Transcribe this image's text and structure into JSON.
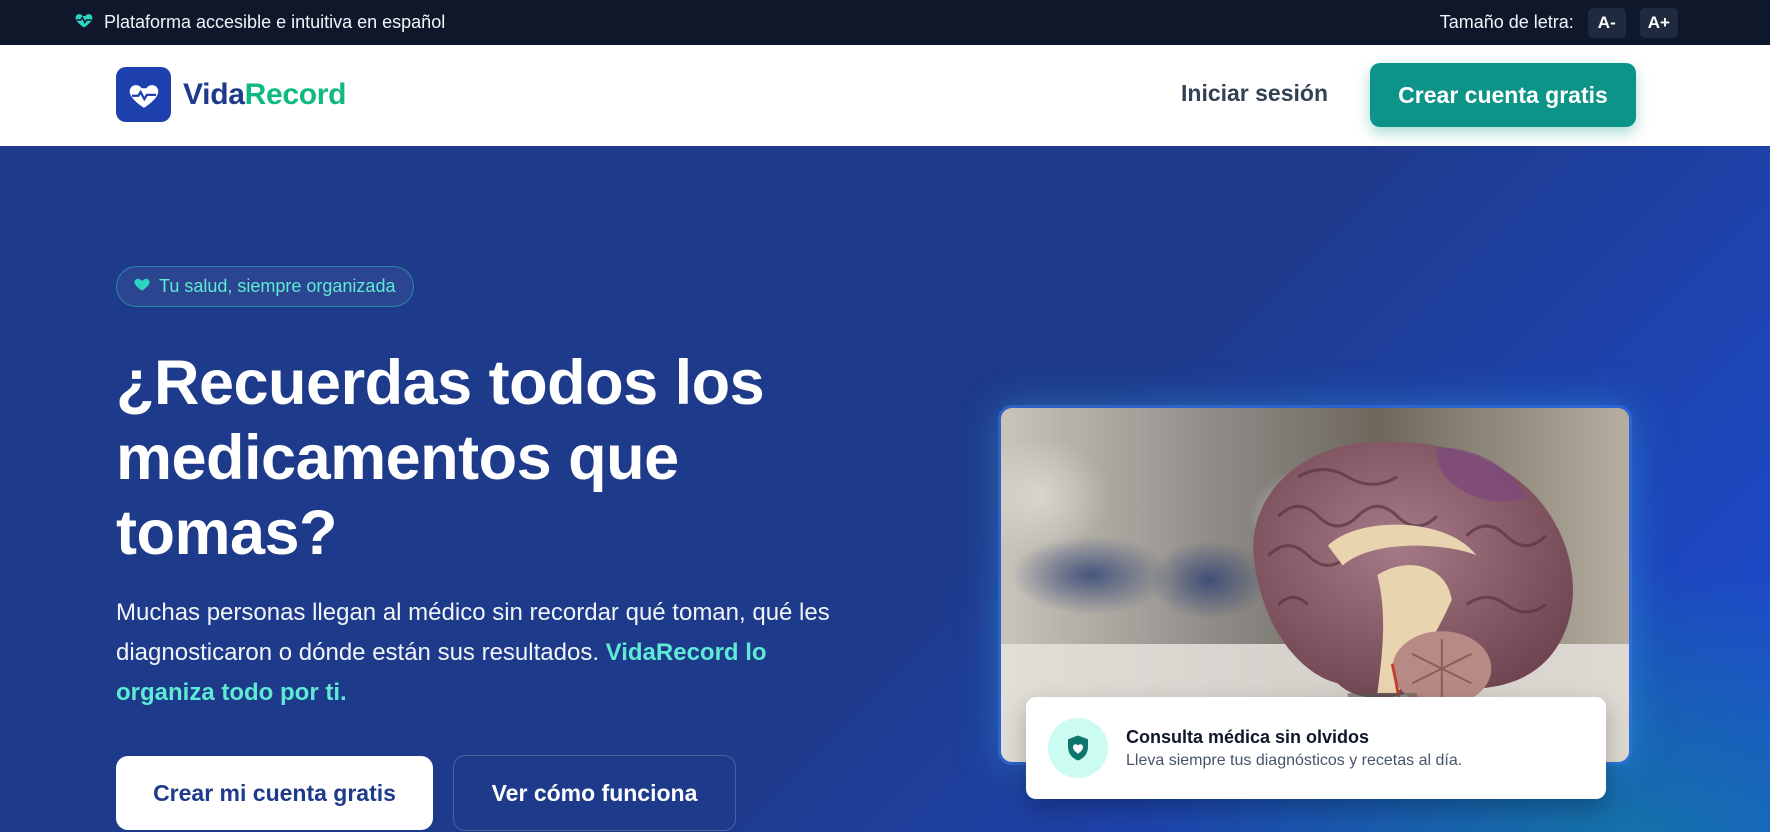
{
  "topbar": {
    "tagline": "Plataforma accesible e intuitiva en español",
    "tagline_icon": "heart-pulse-icon",
    "font_size_label": "Tamaño de letra:",
    "decrease_label": "A-",
    "increase_label": "A+"
  },
  "header": {
    "brand_part1": "Vida",
    "brand_part2": "Record",
    "logo_icon": "heart-pulse-icon",
    "login_label": "Iniciar sesión",
    "cta_label": "Crear cuenta gratis"
  },
  "hero": {
    "pill_label": "Tu salud, siempre organizada",
    "pill_icon": "heart-icon",
    "headline": "¿Recuerdas todos los medicamentos que tomas?",
    "subtext_plain": "Muchas personas llegan al médico sin recordar qué toman, qué les diagnosticaron o dónde están sus resultados. ",
    "subtext_highlight": "VidaRecord lo organiza todo por ti.",
    "primary_button": "Crear mi cuenta gratis",
    "secondary_button": "Ver cómo funciona",
    "image_subject": "anatomical-brain-model",
    "card_title": "Consulta médica sin olvidos",
    "card_subtitle": "Lleva siempre tus diagnósticos y recetas al día.",
    "card_icon": "shield-heart-icon"
  },
  "colors": {
    "topbar_bg": "#0f172a",
    "brand_navy": "#1e3a8a",
    "brand_green": "#10b981",
    "accent_teal": "#0d9488",
    "highlight_teal": "#5eead4"
  }
}
